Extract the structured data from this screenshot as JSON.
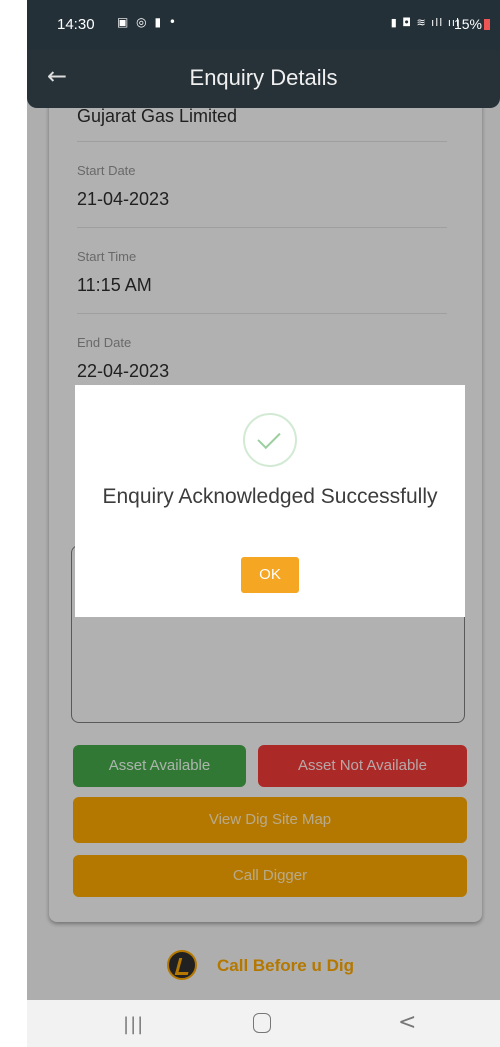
{
  "status_bar": {
    "time": "14:30",
    "left_icons": "▣ ◎ ▮ •",
    "right_icons": "▮ ◘ ≋ ıll ııl",
    "battery": "15%",
    "battery_color": "#e55555"
  },
  "app_bar": {
    "back_icon": "←",
    "title": "Enquiry Details"
  },
  "fields": {
    "company_value": "Gujarat Gas Limited",
    "start_date_label": "Start Date",
    "start_date_value": "21-04-2023",
    "start_time_label": "Start Time",
    "start_time_value": "11:15 AM",
    "end_date_label": "End Date",
    "end_date_value": "22-04-2023"
  },
  "buttons": {
    "asset_available": "Asset Available",
    "asset_not_available": "Asset Not Available",
    "view_map": "View Dig Site Map",
    "call_digger": "Call Digger"
  },
  "footer": {
    "brand": "Call Before u Dig"
  },
  "dialog": {
    "message": "Enquiry Acknowledged Successfully",
    "ok_label": "OK"
  },
  "nav_bar": {
    "recent_icon": "|||",
    "back_icon": "<"
  },
  "colors": {
    "appbar": "#263238",
    "success_green": "#43a047",
    "danger_red": "#e53935",
    "accent_orange": "#f0a000"
  }
}
